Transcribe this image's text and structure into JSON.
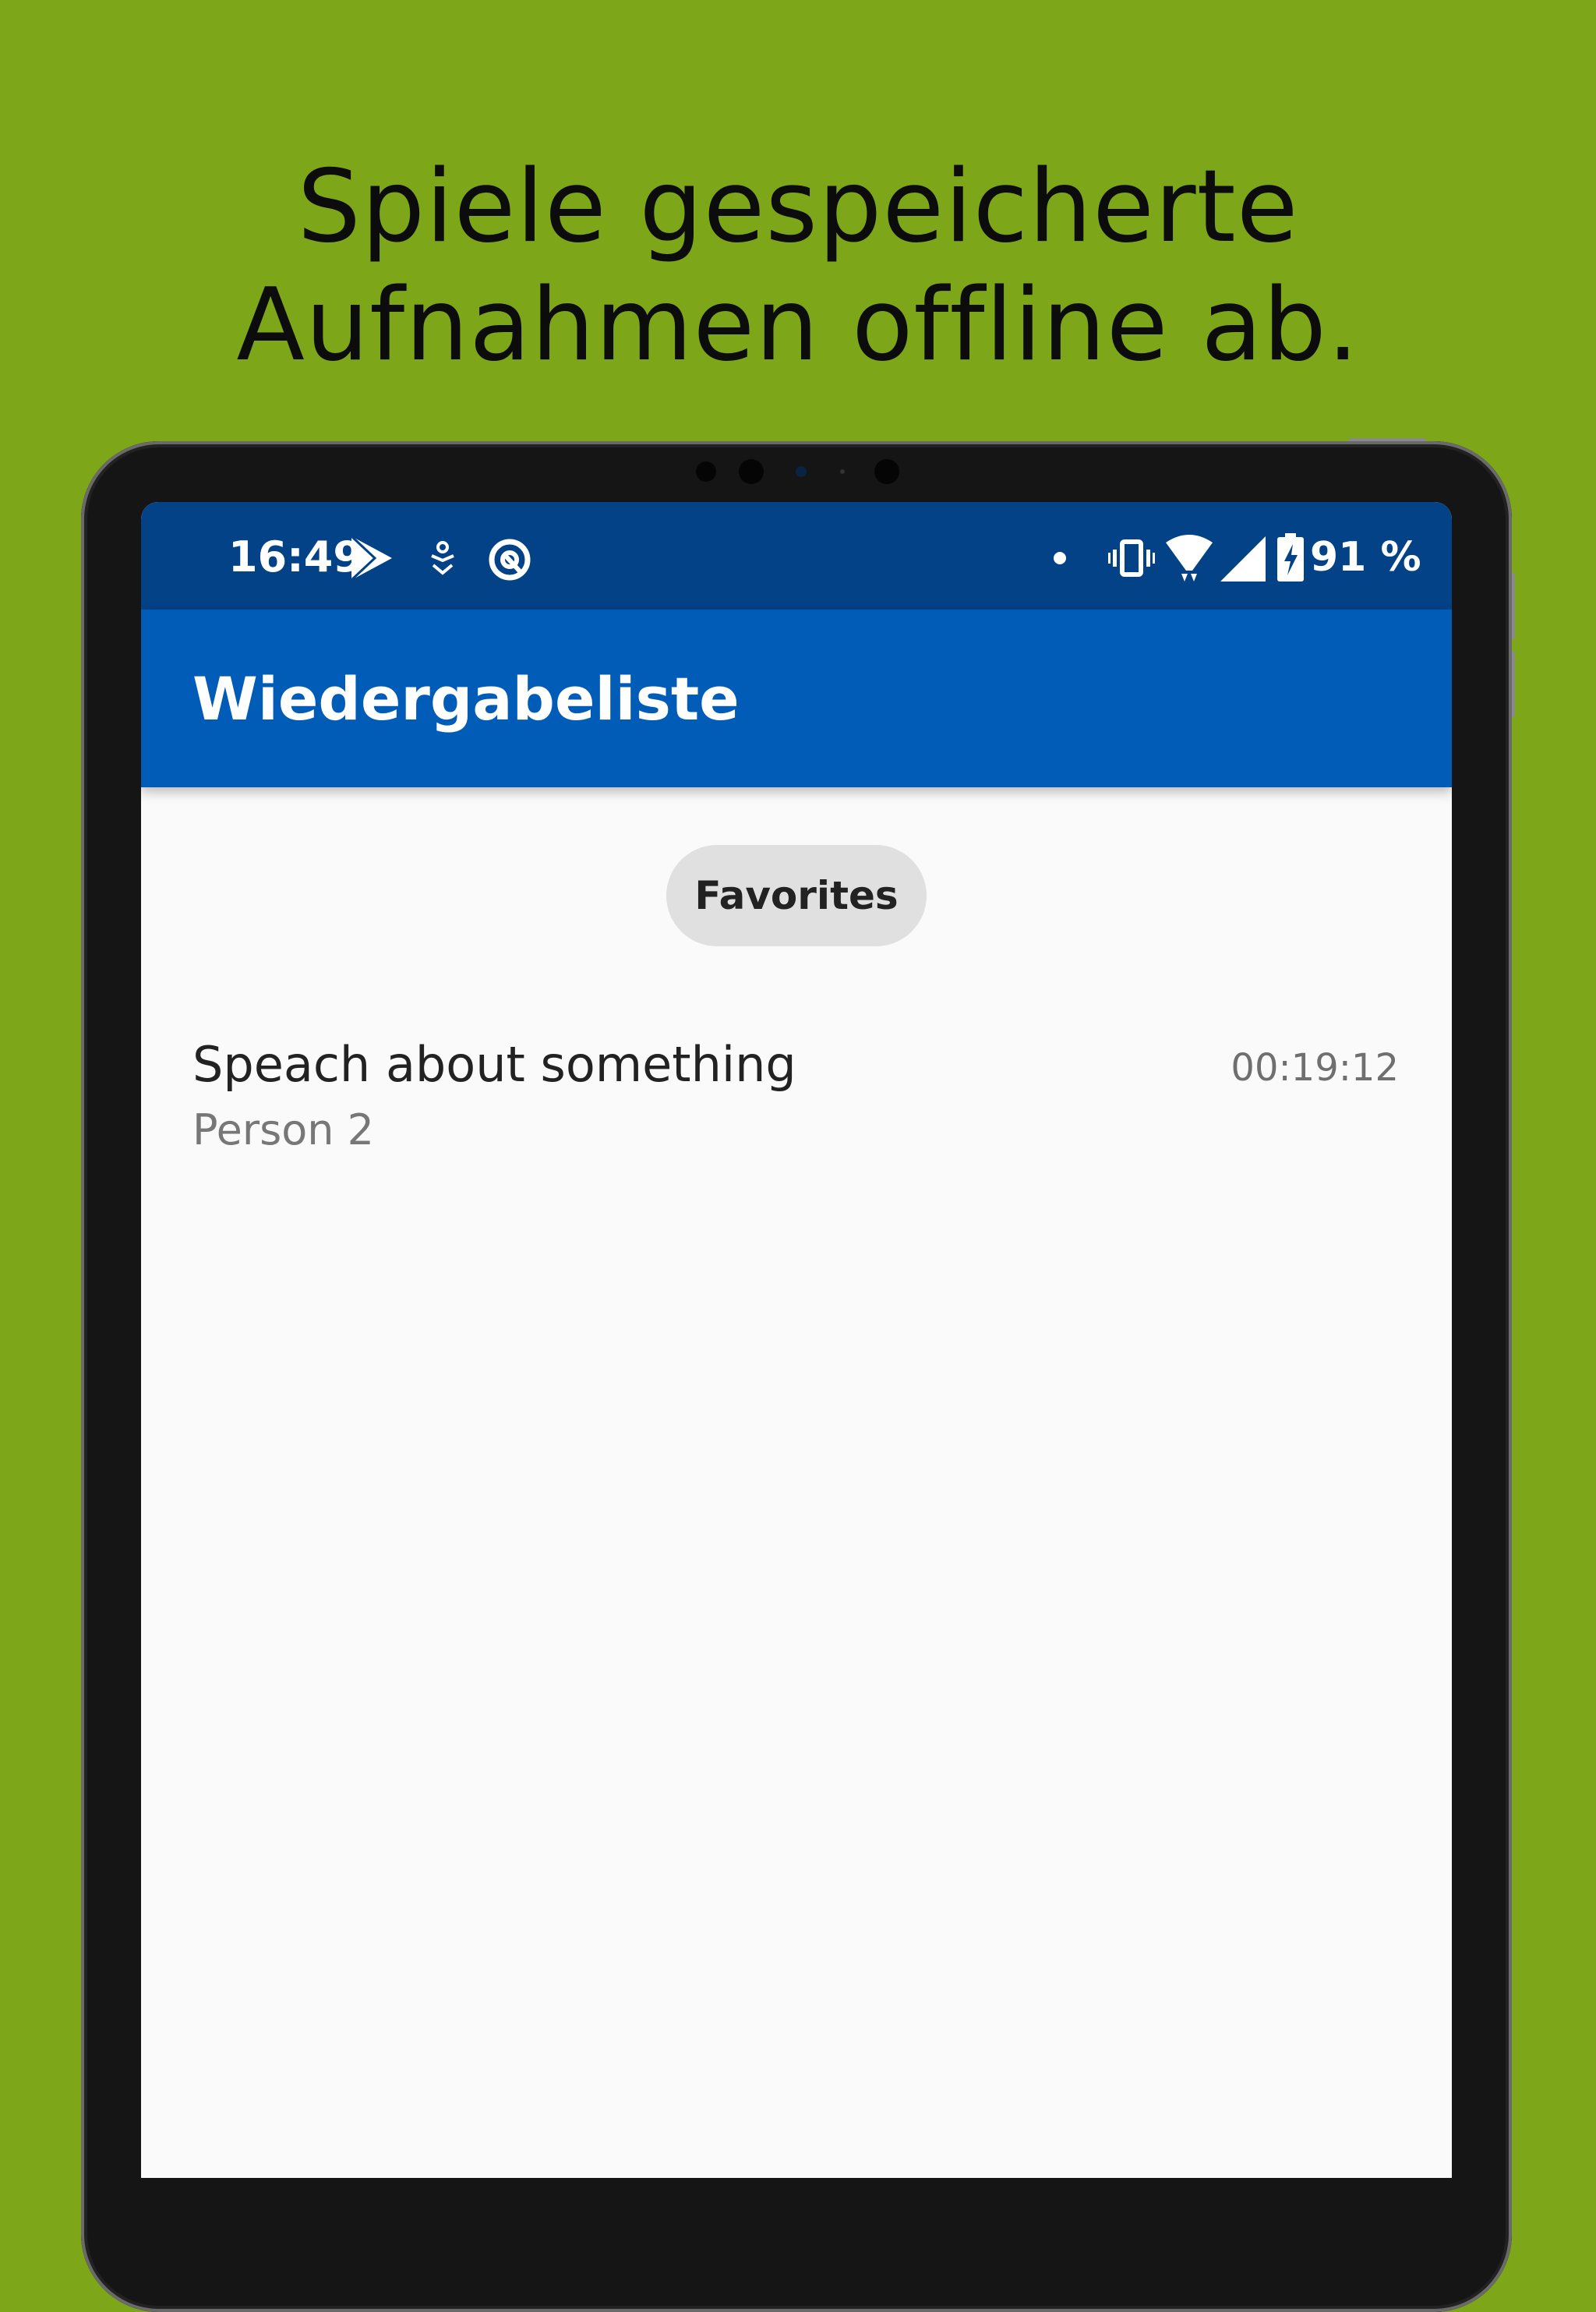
{
  "promo": {
    "line1": "Spiele gespeicherte",
    "line2": "Aufnahmen offline ab."
  },
  "status_bar": {
    "time": "16:49",
    "battery_text": "91 %",
    "left_icons": [
      "play-store-icon",
      "download-icon",
      "data-saver-icon"
    ],
    "right_icons": [
      "notification-dot-icon",
      "vibrate-icon",
      "wifi-icon",
      "cell-signal-icon",
      "battery-charging-icon"
    ]
  },
  "app_bar": {
    "title": "Wiedergabeliste"
  },
  "filter": {
    "chip_label": "Favorites"
  },
  "recordings": [
    {
      "title": "Speach about something",
      "subtitle": "Person 2",
      "duration": "00:19:12"
    }
  ],
  "colors": {
    "background": "#7da619",
    "status_bar": "#034287",
    "app_bar": "#015cb8",
    "screen": "#fafafa",
    "chip": "#e0e0e0"
  }
}
